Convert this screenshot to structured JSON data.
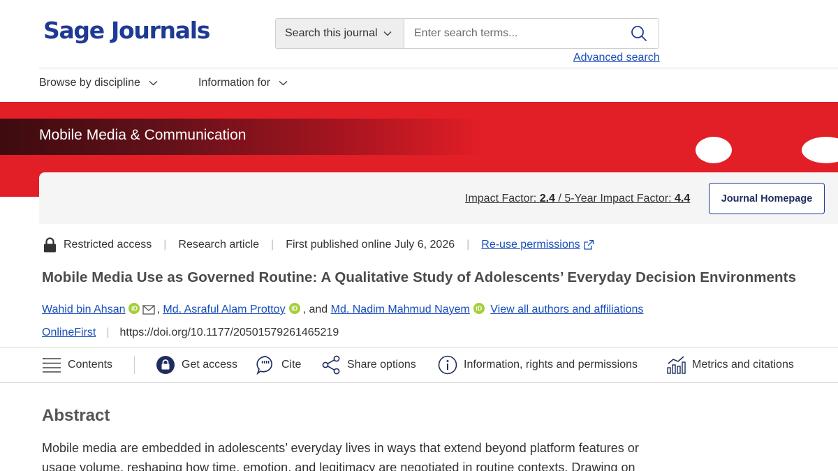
{
  "header": {
    "logo_text": "Sage Journals",
    "search_scope": "Search this journal",
    "search_placeholder": "Enter search terms...",
    "advanced_search": "Advanced search"
  },
  "nav": {
    "browse": "Browse by discipline",
    "info_for": "Information for"
  },
  "banner": {
    "journal_title": "Mobile Media & Communication",
    "impact_label": "Impact Factor:",
    "impact_value": "2.4",
    "slash": "/",
    "five_year_label": "5-Year Impact Factor:",
    "five_year_value": "4.4",
    "homepage_button": "Journal Homepage"
  },
  "meta": {
    "access": "Restricted access",
    "type": "Research article",
    "published": "First published online July 6, 2026",
    "reuse": "Re-use permissions",
    "separator": "|"
  },
  "article": {
    "title": "Mobile Media Use as Governed Routine: A Qualitative Study of Adolescents’ Everyday Decision Environments",
    "authors": [
      {
        "name": "Wahid bin Ahsan"
      },
      {
        "name": "Md. Asraful Alam Prottoy"
      },
      {
        "name": "Md. Nadim Mahmud Nayem"
      }
    ],
    "and_text": ", and",
    "comma": ",",
    "view_all": "View all authors and affiliations",
    "orcid_label": "iD",
    "online_first": "OnlineFirst",
    "doi": "https://doi.org/10.1177/20501579261465219"
  },
  "toolbar": {
    "contents": "Contents",
    "get_access": "Get access",
    "cite": "Cite",
    "share": "Share options",
    "info": "Information, rights and permissions",
    "metrics": "Metrics and citations"
  },
  "abstract": {
    "heading": "Abstract",
    "text": "Mobile media are embedded in adolescents’ everyday lives in ways that extend beyond platform features or usage volume, reshaping how time, emotion, and legitimacy are negotiated in routine contexts. Drawing on"
  },
  "colors": {
    "brand_blue": "#1f3a93",
    "link_blue": "#1a4fba",
    "banner_red": "#e21e26",
    "orcid_green": "#a6ce39"
  },
  "icons": [
    "chevron-down-icon",
    "search-icon",
    "lock-icon",
    "mail-icon",
    "orcid-icon",
    "external-link-icon",
    "menu-lines-icon",
    "padlock-circle-icon",
    "quote-icon",
    "share-icon",
    "info-icon",
    "bar-chart-icon"
  ]
}
